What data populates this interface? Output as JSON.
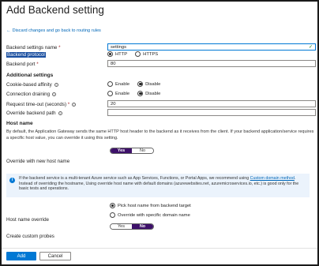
{
  "page": {
    "title": "Add Backend setting"
  },
  "back_link": "Discard changes and go back to routing rules",
  "fields": {
    "name": {
      "label": "Backend settings name",
      "req": "*",
      "value": "settings",
      "check": "✓"
    },
    "protocol": {
      "label": "Backend protocol",
      "options": [
        "HTTP",
        "HTTPS"
      ],
      "selected": "HTTP"
    },
    "port": {
      "label": "Backend port",
      "req": "*",
      "value": "80"
    }
  },
  "additional": {
    "heading": "Additional settings",
    "cookie": {
      "label": "Cookie-based affinity",
      "options": [
        "Enable",
        "Disable"
      ],
      "selected": "Disable"
    },
    "draining": {
      "label": "Connection draining",
      "options": [
        "Enable",
        "Disable"
      ],
      "selected": "Disable"
    },
    "timeout": {
      "label": "Request time-out (seconds)",
      "req": "*",
      "value": "20"
    },
    "override_path": {
      "label": "Override backend path",
      "value": ""
    }
  },
  "hostname": {
    "heading": "Host name",
    "description": "By default, the Application Gateway sends the same HTTP host header to the backend as it receives from the client. If your backend application/service requires a specific host value, you can override it using this setting.",
    "toggle_yes": "Yes",
    "toggle_no": "No",
    "override_label": "Override with new host name",
    "info_pre": "If the backend service is a multi-tenant Azure service such as App Services, Functions, or Portal Apps, we recommend using ",
    "info_link": "Custom domain method",
    "info_post": ". Instead of overriding the hostname, Using override host name with default domains (azurewebsites.net, azuremicroservices.io, etc.) is good only for the basic tests and operations.",
    "opt_pick": "Pick host name from backend target",
    "opt_specific": "Override with specific domain name",
    "hno_label": "Host name override",
    "probes_label": "Create custom probes",
    "probes_yes": "Yes",
    "probes_no": "No"
  },
  "buttons": {
    "add": "Add",
    "cancel": "Cancel"
  }
}
